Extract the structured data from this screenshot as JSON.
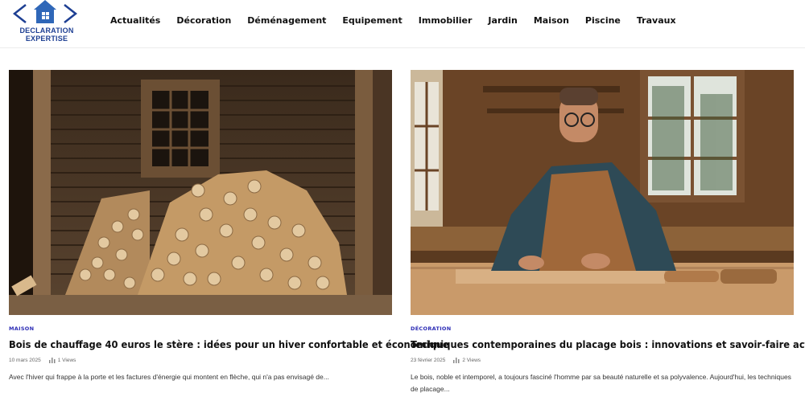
{
  "site": {
    "logo_line1": "DECLARATION",
    "logo_line2": "EXPERTISE",
    "brand_color": "#1d3f93"
  },
  "nav": {
    "items": [
      "Actualités",
      "Décoration",
      "Déménagement",
      "Equipement",
      "Immobilier",
      "Jardin",
      "Maison",
      "Piscine",
      "Travaux"
    ]
  },
  "articles": [
    {
      "category": "MAISON",
      "title": "Bois de chauffage 40 euros le stère : idées pour un hiver confortable et économique",
      "date": "10 mars 2025",
      "views": "1 Views",
      "excerpt": "Avec l'hiver qui frappe à la porte et les factures d'énergie qui montent en flèche, qui n'a pas envisagé de...",
      "image": "firewood-stack-log-cabin"
    },
    {
      "category": "DÉCORATION",
      "title": "Techniques contemporaines du placage bois : innovations et savoir-faire actuels",
      "date": "23 février 2025",
      "views": "2 Views",
      "excerpt": "Le bois, noble et intemporel, a toujours fasciné l'homme par sa beauté naturelle et sa polyvalence. Aujourd'hui, les techniques de placage...",
      "image": "woodworker-in-workshop"
    }
  ],
  "colors": {
    "category": "#2c2cb5",
    "title": "#111111",
    "meta": "#666666"
  }
}
